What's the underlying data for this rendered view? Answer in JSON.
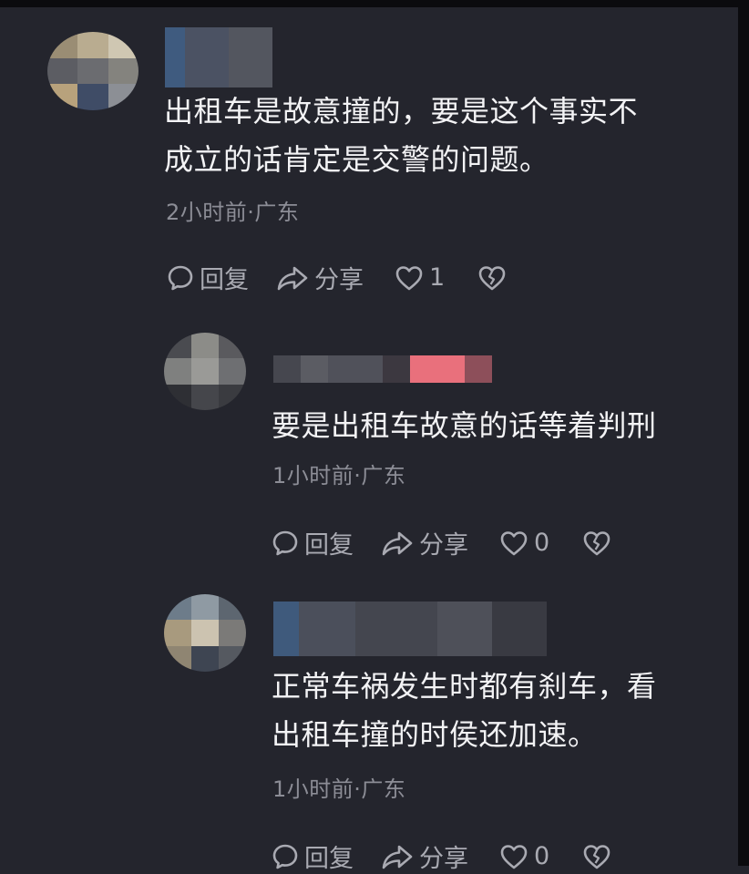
{
  "comments": [
    {
      "text_line1": "出租车是故意撞的，要是这个事实不",
      "text_line2": "成立的话肯定是交警的问题。",
      "meta": "2小时前·广东",
      "reply_label": "回复",
      "share_label": "分享",
      "like_count": "1"
    },
    {
      "text_line1": "要是出租车故意的话等着判刑",
      "text_line2": "",
      "meta": "1小时前·广东",
      "reply_label": "回复",
      "share_label": "分享",
      "like_count": "0"
    },
    {
      "text_line1": "正常车祸发生时都有刹车，看",
      "text_line2": "出租车撞的时侯还加速。",
      "meta": "1小时前·广东",
      "reply_label": "回复",
      "share_label": "分享",
      "like_count": "0"
    }
  ],
  "icons": {
    "reply": "speech-bubble-icon",
    "share": "share-arrow-icon",
    "like": "heart-icon",
    "dislike": "broken-heart-icon"
  },
  "colors": {
    "background": "#24252d",
    "text": "#f3f3f5",
    "meta": "#8c8d96",
    "action": "#a9aab2"
  }
}
